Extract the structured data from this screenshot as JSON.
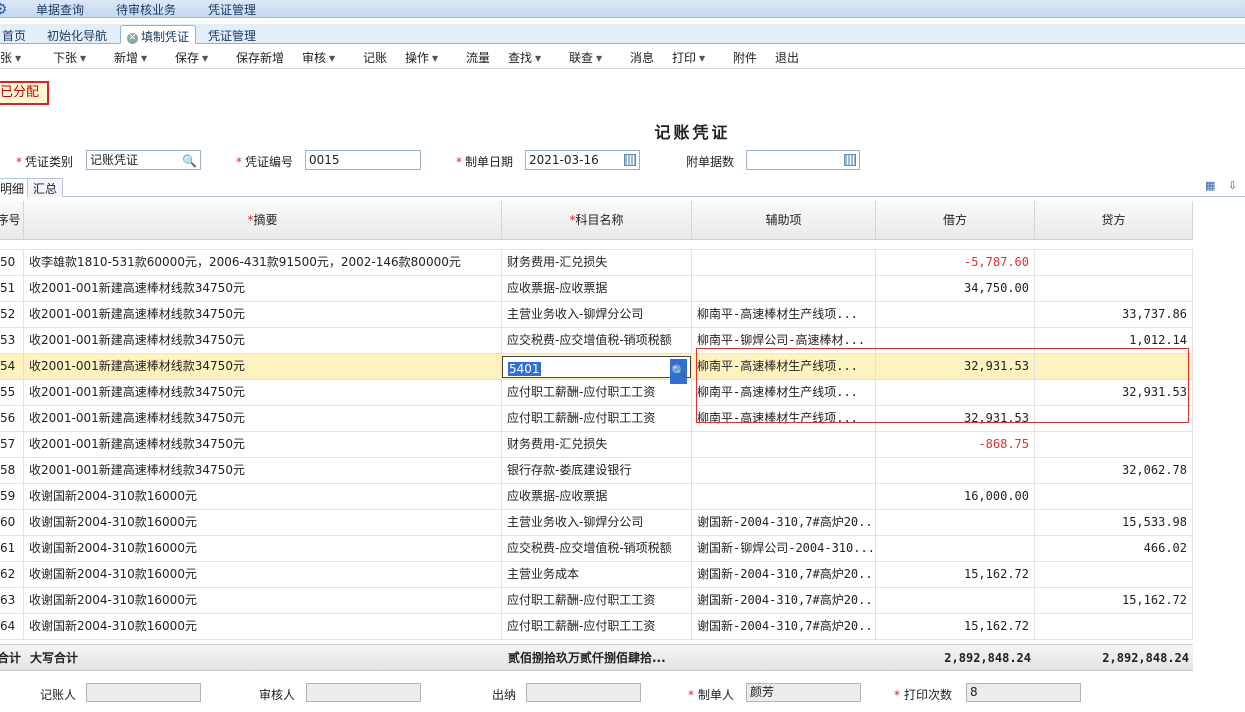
{
  "top_menu": [
    "单据查询",
    "待审核业务",
    "凭证管理"
  ],
  "tabs": [
    "首页",
    "初始化导航",
    "填制凭证",
    "凭证管理"
  ],
  "toolbar": [
    {
      "label": "上张",
      "dropdown": true
    },
    {
      "label": "下张",
      "dropdown": true
    },
    {
      "label": "新增",
      "dropdown": true
    },
    {
      "label": "保存",
      "dropdown": true
    },
    {
      "label": "保存新增",
      "dropdown": false
    },
    {
      "label": "审核",
      "dropdown": true
    },
    {
      "label": "记账",
      "dropdown": false
    },
    {
      "label": "操作",
      "dropdown": true
    },
    {
      "label": "流量",
      "dropdown": false
    },
    {
      "label": "查找",
      "dropdown": true
    },
    {
      "label": "联查",
      "dropdown": true
    },
    {
      "label": "消息",
      "dropdown": false
    },
    {
      "label": "打印",
      "dropdown": true
    },
    {
      "label": "附件",
      "dropdown": false
    },
    {
      "label": "退出",
      "dropdown": false
    }
  ],
  "status_badge": "已分配",
  "voucher_title": "记账凭证",
  "header": {
    "type_label": "凭证类别",
    "type_value": "记账凭证",
    "no_label": "凭证编号",
    "no_value": "0015",
    "date_label": "制单日期",
    "date_value": "2021-03-16",
    "attach_label": "附单据数",
    "attach_value": ""
  },
  "sub_tabs": [
    "明细",
    "汇总"
  ],
  "columns": {
    "seq": "序号",
    "summary": "摘要",
    "account": "科目名称",
    "aux": "辅助项",
    "debit": "借方",
    "credit": "贷方"
  },
  "rows": [
    {
      "seq": "50",
      "summary": "收李雄款1810-531款60000元，2006-431款91500元，2002-146款80000元",
      "account": "财务费用-汇兑损失",
      "aux": "",
      "debit": "-5,787.60",
      "credit": ""
    },
    {
      "seq": "51",
      "summary": "收2001-001新建高速棒材线款34750元",
      "account": "应收票据-应收票据",
      "aux": "",
      "debit": "34,750.00",
      "credit": ""
    },
    {
      "seq": "52",
      "summary": "收2001-001新建高速棒材线款34750元",
      "account": "主营业务收入-铆焊分公司",
      "aux": "柳南平-高速棒材生产线项...",
      "debit": "",
      "credit": "33,737.86"
    },
    {
      "seq": "53",
      "summary": "收2001-001新建高速棒材线款34750元",
      "account": "应交税费-应交增值税-销项税额",
      "aux": "柳南平-铆焊公司-高速棒材...",
      "debit": "",
      "credit": "1,012.14"
    },
    {
      "seq": "54",
      "summary": "收2001-001新建高速棒材线款34750元",
      "account": "5401",
      "aux": "柳南平-高速棒材生产线项...",
      "debit": "32,931.53",
      "credit": ""
    },
    {
      "seq": "55",
      "summary": "收2001-001新建高速棒材线款34750元",
      "account": "应付职工薪酬-应付职工工资",
      "aux": "柳南平-高速棒材生产线项...",
      "debit": "",
      "credit": "32,931.53"
    },
    {
      "seq": "56",
      "summary": "收2001-001新建高速棒材线款34750元",
      "account": "应付职工薪酬-应付职工工资",
      "aux": "柳南平-高速棒材生产线项...",
      "debit": "32,931.53",
      "credit": ""
    },
    {
      "seq": "57",
      "summary": "收2001-001新建高速棒材线款34750元",
      "account": "财务费用-汇兑损失",
      "aux": "",
      "debit": "-868.75",
      "credit": ""
    },
    {
      "seq": "58",
      "summary": "收2001-001新建高速棒材线款34750元",
      "account": "银行存款-娄底建设银行",
      "aux": "",
      "debit": "",
      "credit": "32,062.78"
    },
    {
      "seq": "59",
      "summary": "收谢国新2004-310款16000元",
      "account": "应收票据-应收票据",
      "aux": "",
      "debit": "16,000.00",
      "credit": ""
    },
    {
      "seq": "60",
      "summary": "收谢国新2004-310款16000元",
      "account": "主营业务收入-铆焊分公司",
      "aux": "谢国新-2004-310,7#高炉20...",
      "debit": "",
      "credit": "15,533.98"
    },
    {
      "seq": "61",
      "summary": "收谢国新2004-310款16000元",
      "account": "应交税费-应交增值税-销项税额",
      "aux": "谢国新-铆焊公司-2004-310...",
      "debit": "",
      "credit": "466.02"
    },
    {
      "seq": "62",
      "summary": "收谢国新2004-310款16000元",
      "account": "主营业务成本",
      "aux": "谢国新-2004-310,7#高炉20...",
      "debit": "15,162.72",
      "credit": ""
    },
    {
      "seq": "63",
      "summary": "收谢国新2004-310款16000元",
      "account": "应付职工薪酬-应付职工工资",
      "aux": "谢国新-2004-310,7#高炉20...",
      "debit": "",
      "credit": "15,162.72"
    },
    {
      "seq": "64",
      "summary": "收谢国新2004-310款16000元",
      "account": "应付职工薪酬-应付职工工资",
      "aux": "谢国新-2004-310,7#高炉20...",
      "debit": "15,162.72",
      "credit": ""
    }
  ],
  "total": {
    "label": "合计",
    "summary": "大写合计",
    "account": "贰佰捌拾玖万贰仟捌佰肆拾...",
    "debit": "2,892,848.24",
    "credit": "2,892,848.24"
  },
  "footer": {
    "bookkeeper_label": "记账人",
    "bookkeeper": "",
    "auditor_label": "审核人",
    "auditor": "",
    "cashier_label": "出纳",
    "cashier": "",
    "maker_label": "制单人",
    "maker": "颜芳",
    "print_label": "打印次数",
    "print_count": "8"
  }
}
